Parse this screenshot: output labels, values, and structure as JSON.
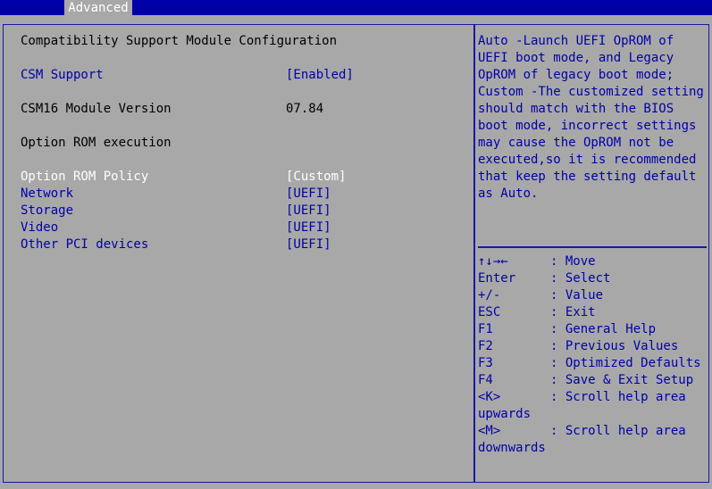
{
  "tabs": {
    "advanced": "Advanced"
  },
  "page": {
    "title": "Compatibility Support Module Configuration",
    "csm_support": {
      "label": "CSM Support",
      "value": "[Enabled]"
    },
    "csm16": {
      "label": "CSM16 Module Version",
      "value": "07.84"
    },
    "section": "Option ROM execution",
    "rom_policy": {
      "label": "Option ROM Policy",
      "value": "[Custom]"
    },
    "network": {
      "label": "Network",
      "value": "[UEFI]"
    },
    "storage": {
      "label": "Storage",
      "value": "[UEFI]"
    },
    "video": {
      "label": "Video",
      "value": "[UEFI]"
    },
    "other_pci": {
      "label": "Other PCI devices",
      "value": "[UEFI]"
    }
  },
  "help": {
    "text": "Auto -Launch UEFI OpROM of\nUEFI boot mode, and Legacy\nOpROM of legacy boot mode;\nCustom -The customized setting\nshould match with the BIOS\nboot mode, incorrect settings\nmay cause the OpROM not be\nexecuted,so it is recommended\nthat keep the setting default\nas Auto."
  },
  "keys": [
    {
      "key": "↑↓→←",
      "desc": ": Move"
    },
    {
      "key": "Enter",
      "desc": ": Select"
    },
    {
      "key": "+/-",
      "desc": ": Value"
    },
    {
      "key": "ESC",
      "desc": ": Exit"
    },
    {
      "key": "F1",
      "desc": ": General Help"
    },
    {
      "key": "F2",
      "desc": ": Previous Values"
    },
    {
      "key": "F3",
      "desc": ": Optimized Defaults"
    },
    {
      "key": "F4",
      "desc": ": Save & Exit Setup"
    },
    {
      "key": "<K>",
      "desc": ": Scroll help area"
    },
    {
      "key": "upwards",
      "desc": ""
    },
    {
      "key": "<M>",
      "desc": ": Scroll help area"
    },
    {
      "key": "downwards",
      "desc": ""
    }
  ]
}
